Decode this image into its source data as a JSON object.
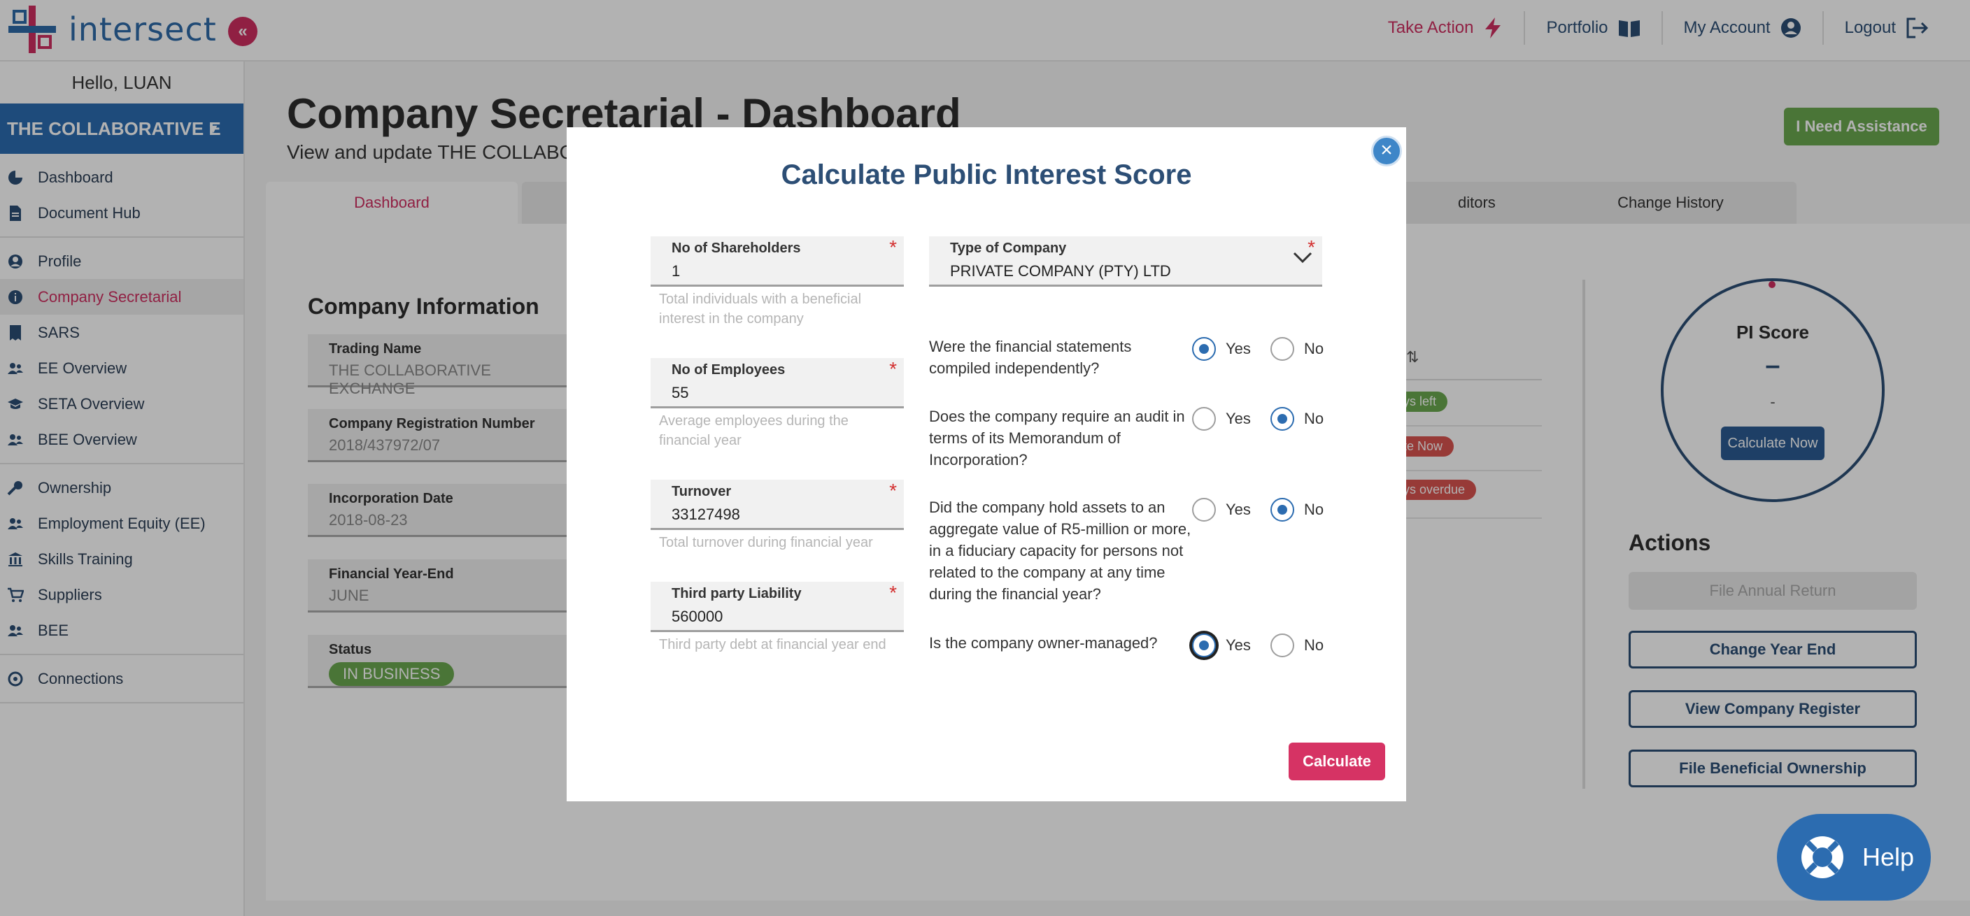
{
  "app": {
    "logo_text": "intersect",
    "collapse_glyph": "«"
  },
  "topnav": [
    {
      "label": "Take Action",
      "icon": "lightning-icon"
    },
    {
      "label": "Portfolio",
      "icon": "book-icon"
    },
    {
      "label": "My Account",
      "icon": "user-circle-icon"
    },
    {
      "label": "Logout",
      "icon": "logout-icon"
    }
  ],
  "sidebar": {
    "greeting": "Hello, LUAN",
    "company": "THE COLLABORATIVE E",
    "groups": [
      [
        {
          "label": "Dashboard",
          "icon": "pie-chart-icon"
        },
        {
          "label": "Document Hub",
          "icon": "document-icon"
        }
      ],
      [
        {
          "label": "Profile",
          "icon": "user-icon"
        },
        {
          "label": "Company Secretarial",
          "icon": "info-icon",
          "active": true
        },
        {
          "label": "SARS",
          "icon": "receipt-icon"
        },
        {
          "label": "EE Overview",
          "icon": "users-icon"
        },
        {
          "label": "SETA Overview",
          "icon": "graduation-icon"
        },
        {
          "label": "BEE Overview",
          "icon": "users-icon"
        }
      ],
      [
        {
          "label": "Ownership",
          "icon": "key-icon"
        },
        {
          "label": "Employment Equity (EE)",
          "icon": "users-icon"
        },
        {
          "label": "Skills Training",
          "icon": "building-icon"
        },
        {
          "label": "Suppliers",
          "icon": "cart-icon"
        },
        {
          "label": "BEE",
          "icon": "users-icon"
        }
      ],
      [
        {
          "label": "Connections",
          "icon": "connections-icon"
        }
      ]
    ]
  },
  "page": {
    "title": "Company Secretarial - Dashboard",
    "subtitle": "View and update THE COLLABOR",
    "assist_label": "I Need Assistance",
    "tabs": [
      "Dashboard",
      "",
      "ditors",
      "Change History"
    ]
  },
  "company_info": {
    "title": "Company Information",
    "fields": [
      {
        "label": "Trading Name",
        "value": "THE COLLABORATIVE EXCHANGE"
      },
      {
        "label": "Company Registration Number",
        "value": "2018/437972/07"
      },
      {
        "label": "Incorporation Date",
        "value": "2018-08-23"
      },
      {
        "label": "Financial Year-End",
        "value": "JUNE"
      },
      {
        "label": "Status",
        "value": "IN BUSINESS"
      }
    ]
  },
  "tasks": {
    "sort_glyph": "⇅",
    "pills": [
      {
        "text": "ys left",
        "color": "#6aa84f"
      },
      {
        "text": "te Now",
        "color": "#d9534f"
      },
      {
        "text": "ys overdue",
        "color": "#d9534f"
      }
    ]
  },
  "pi_score": {
    "title": "PI Score",
    "value": "–",
    "sub": "-",
    "button": "Calculate Now"
  },
  "actions": {
    "title": "Actions",
    "buttons": [
      "File Annual Return",
      "Change Year End",
      "View Company Register",
      "File Beneficial Ownership"
    ]
  },
  "help": {
    "label": "Help"
  },
  "modal": {
    "title": "Calculate Public Interest Score",
    "close_glyph": "×",
    "fields": {
      "shareholders": {
        "label": "No of Shareholders",
        "value": "1",
        "help": "Total individuals with a beneficial interest in the company"
      },
      "employees": {
        "label": "No of Employees",
        "value": "55",
        "help": "Average employees during the financial year"
      },
      "turnover": {
        "label": "Turnover",
        "value": "33127498",
        "help": "Total turnover during financial year"
      },
      "liability": {
        "label": "Third party Liability",
        "value": "560000",
        "help": "Third party debt at financial year end"
      },
      "company_type": {
        "label": "Type of Company",
        "value": "PRIVATE COMPANY (PTY) LTD"
      }
    },
    "required_mark": "*",
    "questions": [
      {
        "text": "Were the financial statements compiled independently?",
        "answer": "Yes"
      },
      {
        "text": "Does the company require an audit in terms of its Memorandum of Incorporation?",
        "answer": "No"
      },
      {
        "text": "Did the company hold assets to an aggregate value of R5-million or more, in a fiduciary capacity for persons not related to the company at any time during the financial year?",
        "answer": "No"
      },
      {
        "text": "Is the company owner-managed?",
        "answer": "Yes"
      }
    ],
    "yes_label": "Yes",
    "no_label": "No",
    "calculate_label": "Calculate"
  },
  "colors": {
    "brand_blue": "#2b6cb0",
    "accent_pink": "#cf2f61",
    "success_green": "#6aa84f"
  }
}
